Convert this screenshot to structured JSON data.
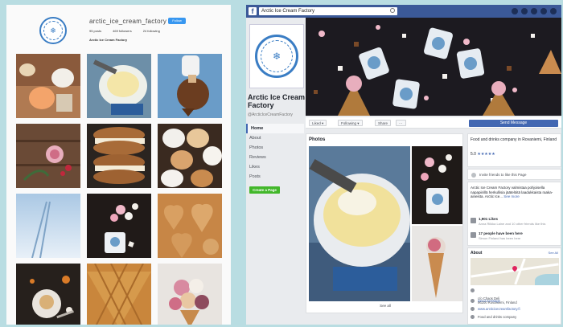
{
  "instagram": {
    "username": "arctic_ice_cream_factory",
    "follow_label": "Follow",
    "stats": {
      "posts": "95 posts",
      "followers": "469 followers",
      "following": "24 following"
    },
    "bio_name": "Arctic Ice Cream Factory",
    "posts": [
      {
        "subject": "ice-cream-cups-table"
      },
      {
        "subject": "scooping-ice-cream"
      },
      {
        "subject": "dipped-cookie"
      },
      {
        "subject": "berries-on-wood"
      },
      {
        "subject": "ice-cream-sandwiches"
      },
      {
        "subject": "chocolate-dipped-cookies"
      },
      {
        "subject": "ski-tracks-snow"
      },
      {
        "subject": "marshmallow-cup"
      },
      {
        "subject": "heart-cookies"
      },
      {
        "subject": "dessert-plate-dark"
      },
      {
        "subject": "waffle-cones"
      },
      {
        "subject": "ice-cream-scoops-cone"
      }
    ]
  },
  "facebook": {
    "search_value": "Arctic Ice Cream Factory",
    "page_name": "Arctic Ice Cream Factory",
    "handle": "@ArcticIceCreamFactory",
    "nav": [
      "Home",
      "About",
      "Photos",
      "Reviews",
      "Likes",
      "Posts"
    ],
    "create_page_label": "Create a Page",
    "actions": {
      "liked": "Liked ▾",
      "following": "Following ▾",
      "share": "Share",
      "more": "···",
      "send_message": "Send Message"
    },
    "photos_title": "Photos",
    "see_all": "See all",
    "tagline": "Food and drinks company in Rovaniemi, Finland",
    "rating": "5.0",
    "stars": "★★★★★",
    "invite": "Invite friends to like this Page",
    "description": "Arctic Ice Cream Factory valmistaa pohjoisella napapiirillä herkullisia jäätelöitä laadukkaista raaka-aineista. Arctic Ice...",
    "see_more": "See more",
    "likes_count": "1,901 Likes",
    "likes_sub": "Anna Riikka Laine and 10 other friends like this",
    "follows_count": "17 people have been here",
    "follows_sub": "Simon Finland has been here",
    "about_title": "About",
    "about_see_all": "See All",
    "address": "c/o Chaos Deli\n96200 Rovaniemi, Finland",
    "send_message_link": "Send message",
    "website": "www.arcticicecreamfactory.fi",
    "category": "Food and drinks company"
  },
  "colors": {
    "fb_blue": "#3b5998",
    "fb_button": "#4267b2",
    "ig_follow": "#3897f0",
    "logo_blue": "#3a7dc4",
    "create_green": "#42b72a",
    "background": "#b9dde2"
  }
}
